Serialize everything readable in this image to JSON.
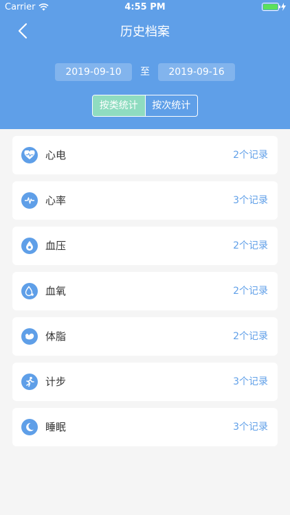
{
  "status_bar": {
    "carrier": "Carrier",
    "time": "4:55 PM"
  },
  "nav": {
    "title": "历史档案"
  },
  "date_range": {
    "start": "2019-09-10",
    "separator": "至",
    "end": "2019-09-16"
  },
  "segments": [
    {
      "label": "按类统计",
      "active": true
    },
    {
      "label": "按次统计",
      "active": false
    }
  ],
  "records": [
    {
      "label": "心电",
      "count": "2个记录",
      "icon": "heart-ecg-icon"
    },
    {
      "label": "心率",
      "count": "3个记录",
      "icon": "pulse-icon"
    },
    {
      "label": "血压",
      "count": "2个记录",
      "icon": "blood-pressure-icon"
    },
    {
      "label": "血氧",
      "count": "2个记录",
      "icon": "blood-drop-icon"
    },
    {
      "label": "体脂",
      "count": "2个记录",
      "icon": "muscle-icon"
    },
    {
      "label": "计步",
      "count": "3个记录",
      "icon": "running-icon"
    },
    {
      "label": "睡眠",
      "count": "3个记录",
      "icon": "moon-icon"
    }
  ],
  "colors": {
    "header": "#5f9fe8",
    "segment_active": "#8fdcc0",
    "accent": "#5f9fe8"
  }
}
